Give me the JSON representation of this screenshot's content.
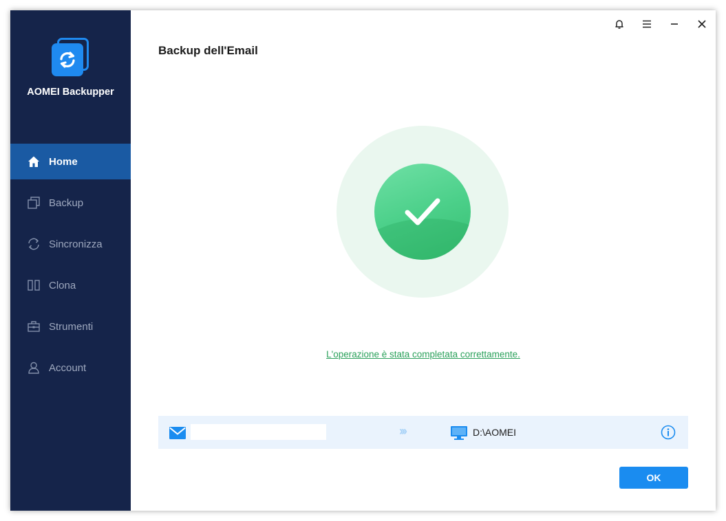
{
  "app": {
    "name": "AOMEI Backupper",
    "logo_icon": "sync-arrows-icon",
    "accent_color": "#1a8cf0",
    "sidebar_color": "#15244a"
  },
  "sidebar": {
    "items": [
      {
        "label": "Home",
        "icon": "home-icon",
        "active": true
      },
      {
        "label": "Backup",
        "icon": "copy-icon",
        "active": false
      },
      {
        "label": "Sincronizza",
        "icon": "sync-icon",
        "active": false
      },
      {
        "label": "Clona",
        "icon": "clone-icon",
        "active": false
      },
      {
        "label": "Strumenti",
        "icon": "toolbox-icon",
        "active": false
      },
      {
        "label": "Account",
        "icon": "user-icon",
        "active": false
      }
    ]
  },
  "titlebar": {
    "buttons": [
      "bell-icon",
      "menu-icon",
      "minimize-icon",
      "close-icon"
    ]
  },
  "main": {
    "title": "Backup dell'Email",
    "status_icon": "check-circle-icon",
    "success_color": "#2aa05a",
    "result_message": "L'operazione è stata completata correttamente.",
    "route": {
      "source_icon": "mail-icon",
      "source_value": "",
      "arrow": "›››",
      "destination_icon": "monitor-icon",
      "destination": "D:\\AOMEI",
      "info_icon": "info-icon"
    },
    "ok_label": "OK"
  }
}
